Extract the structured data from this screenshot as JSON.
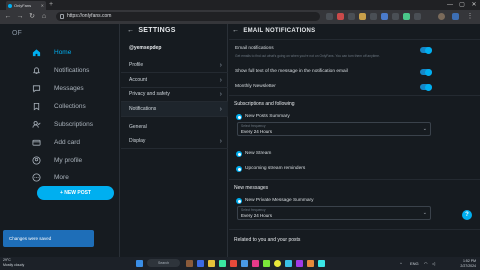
{
  "browser": {
    "tab_title": "OnlyFans",
    "tab_close": "✕",
    "new_tab": "+",
    "url": "https://onlyfans.com",
    "win_min": "—",
    "win_max": "▢",
    "win_close": "✕"
  },
  "sidebar": {
    "brand": "OF",
    "items": [
      {
        "label": "Home",
        "icon": "home-icon"
      },
      {
        "label": "Notifications",
        "icon": "bell-icon"
      },
      {
        "label": "Messages",
        "icon": "chat-icon"
      },
      {
        "label": "Collections",
        "icon": "bookmark-icon"
      },
      {
        "label": "Subscriptions",
        "icon": "user-check-icon"
      },
      {
        "label": "Add card",
        "icon": "card-icon"
      },
      {
        "label": "My profile",
        "icon": "user-icon"
      },
      {
        "label": "More",
        "icon": "more-icon"
      }
    ],
    "new_post": "+ NEW POST"
  },
  "settings": {
    "title": "SETTINGS",
    "username": "@yemsepdep",
    "rows": [
      "Profile",
      "Account",
      "Privacy and safety",
      "Notifications",
      "General",
      "Display"
    ]
  },
  "content": {
    "title": "EMAIL NOTIFICATIONS",
    "email_notifications_label": "Email notifications",
    "email_notifications_sub": "Get emails to find out what's going on when you're not on OnlyFans. You can turn them off anytime.",
    "full_text_label": "Show full text of the message in the notification email",
    "newsletter_label": "Monthly Newsletter",
    "subscriptions_section": "Subscriptions and following",
    "new_posts_summary": "New Posts Summary",
    "new_posts_select_label": "Select frequency",
    "new_posts_select_value": "Every 24 Hours",
    "new_stream": "New Stream",
    "upcoming_stream": "Upcoming stream reminders",
    "new_messages_section": "New messages",
    "new_private_summary": "New Private Message Summary",
    "private_select_label": "Select frequency",
    "private_select_value": "Every 24 Hours",
    "related_section": "Related to you and your posts",
    "help": "?"
  },
  "toast": "Changes were saved",
  "taskbar": {
    "weather_temp": "29°C",
    "weather_text": "Mostly cloudy",
    "search": "Search",
    "time": "1:52 PM",
    "date": "2/27/2024",
    "lang": "ENG"
  },
  "colors": {
    "accent": "#00aff0",
    "background": "#161b20"
  }
}
